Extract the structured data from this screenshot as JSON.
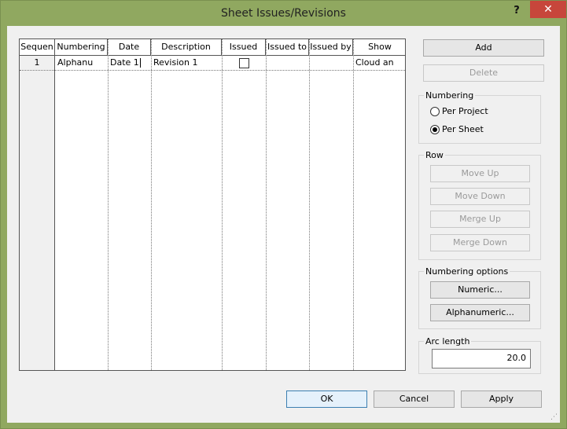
{
  "window": {
    "title": "Sheet Issues/Revisions",
    "help": "?",
    "close": "✕"
  },
  "table": {
    "headers": [
      "Sequen",
      "Numbering",
      "Date",
      "Description",
      "Issued",
      "Issued to",
      "Issued by",
      "Show"
    ],
    "rows": [
      {
        "sequence": "1",
        "numbering": "Alphanu",
        "date": "Date 1",
        "description": "Revision 1",
        "issued": false,
        "issued_to": "",
        "issued_by": "",
        "show": "Cloud an"
      }
    ]
  },
  "buttons": {
    "add": "Add",
    "delete": "Delete"
  },
  "numbering": {
    "label": "Numbering",
    "options": [
      "Per Project",
      "Per Sheet"
    ],
    "selected": "Per Sheet"
  },
  "row": {
    "label": "Row",
    "move_up": "Move Up",
    "move_down": "Move Down",
    "merge_up": "Merge Up",
    "merge_down": "Merge Down"
  },
  "numbering_options": {
    "label": "Numbering options",
    "numeric": "Numeric...",
    "alphanumeric": "Alphanumeric..."
  },
  "arc_length": {
    "label": "Arc length",
    "value": "20.0"
  },
  "footer": {
    "ok": "OK",
    "cancel": "Cancel",
    "apply": "Apply"
  }
}
